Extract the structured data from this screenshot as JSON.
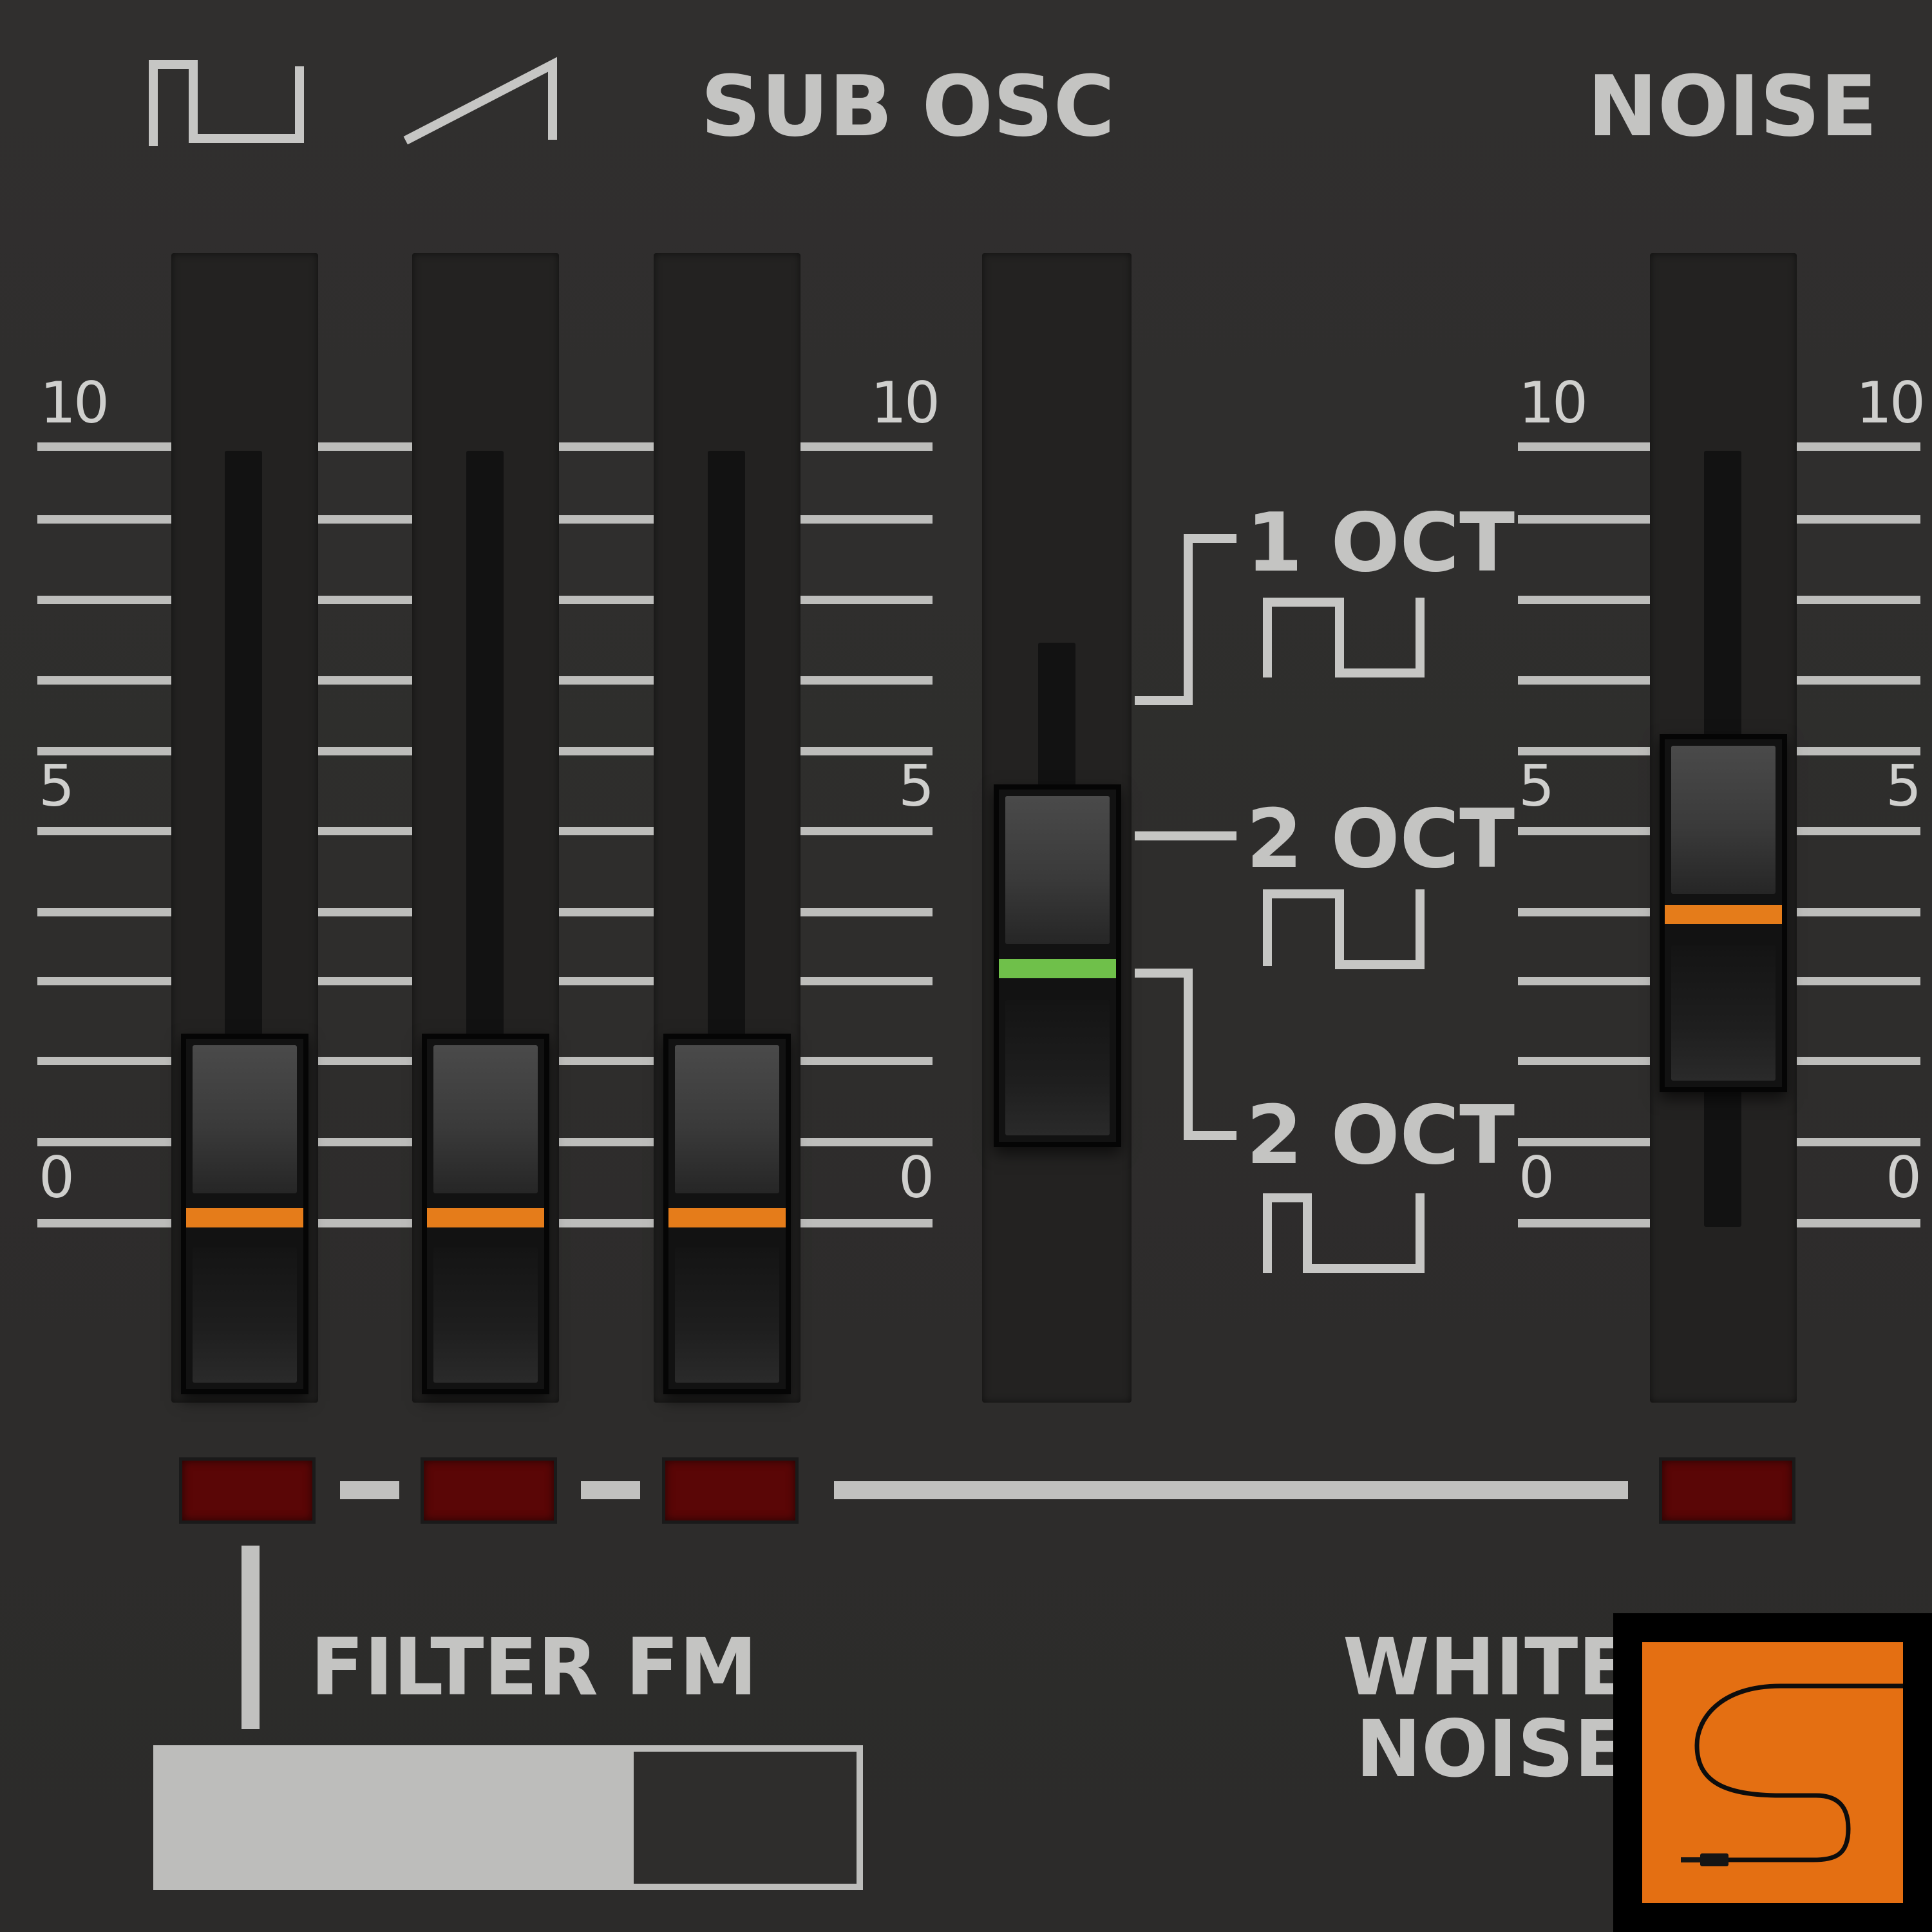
{
  "headers": {
    "square_wave_icon": "square-wave",
    "sawtooth_wave_icon": "sawtooth-wave",
    "sub_osc": "SUB OSC",
    "noise": "NOISE"
  },
  "scale": {
    "top": "10",
    "mid": "5",
    "bottom": "0"
  },
  "sliders": [
    {
      "id": "pulse-level",
      "value_fraction": 0.0,
      "line_color": "#e57c1a"
    },
    {
      "id": "saw-level",
      "value_fraction": 0.0,
      "line_color": "#e57c1a"
    },
    {
      "id": "sub-osc-level",
      "value_fraction": 0.0,
      "line_color": "#e57c1a"
    },
    {
      "id": "noise-level",
      "value_fraction": 0.4,
      "line_color": "#e57c1a"
    }
  ],
  "sub_osc_selector": {
    "options": [
      "1 OCT",
      "2 OCT",
      "2 OCT"
    ],
    "selected_index": 2,
    "line_color": "#6fc04a"
  },
  "filter_fm": {
    "label": "FILTER FM",
    "value_fraction": 0.68
  },
  "white_noise": {
    "label_line1": "WHITE",
    "label_line2": "NOISE",
    "button_icon": "patch-cable-icon",
    "color": "#e46f12"
  },
  "colors": {
    "led_off": "#5a0606",
    "panel": "#2e2d2c",
    "text": "#c4c4c2"
  }
}
